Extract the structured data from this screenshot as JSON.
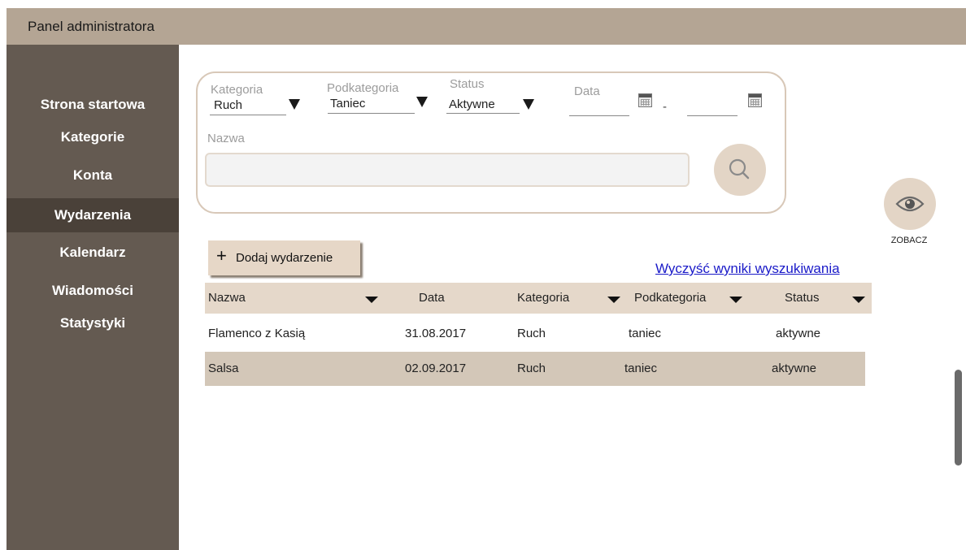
{
  "header": {
    "title": "Panel administratora"
  },
  "sidebar": {
    "items": [
      {
        "label": "Strona startowa"
      },
      {
        "label": "Kategorie"
      },
      {
        "label": "Konta"
      },
      {
        "label": "Wydarzenia",
        "active": true
      },
      {
        "label": "Kalendarz"
      },
      {
        "label": "Wiadomości"
      },
      {
        "label": "Statystyki"
      }
    ]
  },
  "filters": {
    "category": {
      "label": "Kategoria",
      "value": "Ruch"
    },
    "subcategory": {
      "label": "Podkategoria",
      "value": "Taniec"
    },
    "status": {
      "label": "Status",
      "value": "Aktywne"
    },
    "date": {
      "label": "Data",
      "from": "",
      "to": "",
      "separator": "-"
    },
    "name": {
      "label": "Nazwa",
      "value": ""
    }
  },
  "actions": {
    "add_label": "Dodaj wydarzenie",
    "add_icon": "+",
    "clear_label": "Wyczyść wyniki wyszukiwania",
    "view_label": "ZOBACZ"
  },
  "table": {
    "columns": [
      "Nazwa",
      "Data",
      "Kategoria",
      "Podkategoria",
      "Status"
    ],
    "rows": [
      [
        "Flamenco z Kasią",
        "31.08.2017",
        "Ruch",
        "taniec",
        "aktywne"
      ],
      [
        "Salsa",
        "02.09.2017",
        "Ruch",
        "taniec",
        "aktywne"
      ]
    ]
  },
  "icons": {
    "search": "search-icon",
    "view": "eye-icon",
    "calendar": "calendar-icon",
    "dropdown": "dropdown-triangle-icon"
  },
  "colors": {
    "topbar": "#b4a594",
    "sidebar": "#645a51",
    "sidebar_active": "#4a4139",
    "accent": "#e3d5c6",
    "table_header": "#e5d8ca",
    "row_alt": "#d3c7b8",
    "link": "#1a1ac8"
  }
}
